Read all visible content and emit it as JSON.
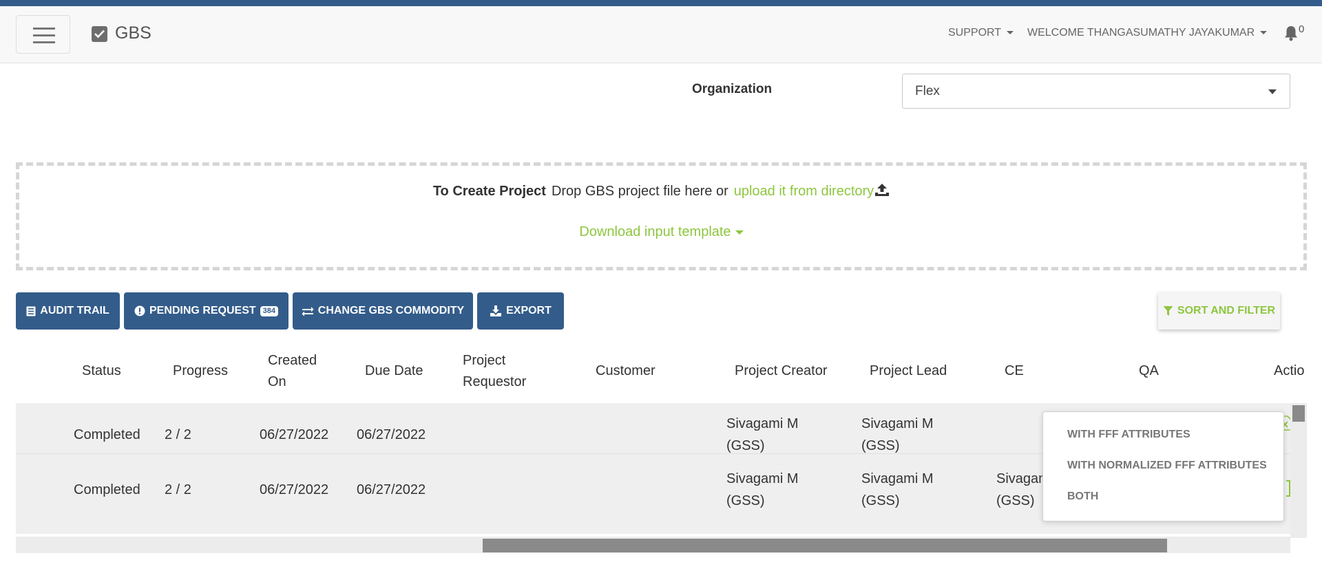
{
  "nav": {
    "brand": "GBS",
    "support_label": "SUPPORT",
    "welcome_label": "WELCOME THANGASUMATHY JAYAKUMAR",
    "notification_count": "0"
  },
  "organization": {
    "label": "Organization",
    "value": "Flex"
  },
  "dropzone": {
    "title": "To Create Project",
    "text": "Drop GBS project file here or",
    "link": "upload it from directory",
    "template_label": "Download input template"
  },
  "toolbar": {
    "audit_trail": "AUDIT TRAIL",
    "pending_request": "PENDING REQUEST",
    "pending_count": "384",
    "change_commodity": "CHANGE GBS COMMODITY",
    "export": "EXPORT",
    "sort_filter": "SORT AND FILTER"
  },
  "table": {
    "headers": {
      "status": "Status",
      "progress": "Progress",
      "created_l1": "Created",
      "created_l2": "On",
      "due": "Due Date",
      "requestor_l1": "Project",
      "requestor_l2": "Requestor",
      "customer": "Customer",
      "creator": "Project Creator",
      "lead": "Project Lead",
      "ce": "CE",
      "qa": "QA",
      "action": "Actio"
    },
    "rows": [
      {
        "status": "Completed",
        "progress": "2 / 2",
        "created": "06/27/2022",
        "due": "06/27/2022",
        "creator_l1": "Sivagami M",
        "creator_l2": "(GSS)",
        "lead_l1": "Sivagami M",
        "lead_l2": "(GSS)",
        "ce_l1": "",
        "ce_l2": ""
      },
      {
        "status": "Completed",
        "progress": "2 / 2",
        "created": "06/27/2022",
        "due": "06/27/2022",
        "creator_l1": "Sivagami M",
        "creator_l2": "(GSS)",
        "lead_l1": "Sivagami M",
        "lead_l2": "(GSS)",
        "ce_l1": "Sivagami M",
        "ce_l2": "(GSS)"
      }
    ]
  },
  "export_menu": {
    "items": [
      "WITH FFF ATTRIBUTES",
      "WITH NORMALIZED FFF ATTRIBUTES",
      "BOTH"
    ]
  },
  "colors": {
    "primary": "#335c8a",
    "accent_green": "#8dc63f",
    "row_bg": "#efefef"
  }
}
